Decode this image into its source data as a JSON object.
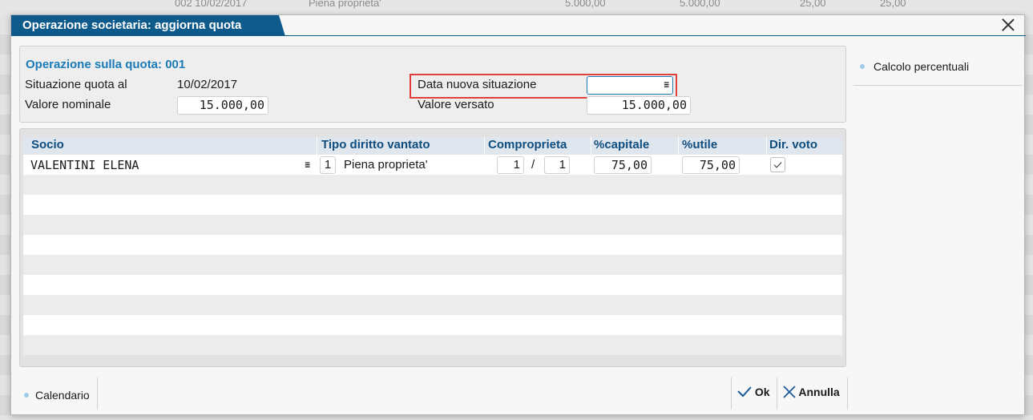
{
  "background_row": {
    "cells": [
      "002 10/02/2017",
      "Piena proprieta'",
      "5.000,00",
      "5.000,00",
      "25,00",
      "25,00"
    ]
  },
  "dialog": {
    "title": "Operazione societaria: aggiorna quota",
    "close_icon": "close-icon"
  },
  "header_panel": {
    "section_title": "Operazione sulla quota: 001",
    "situazione_label": "Situazione quota al",
    "situazione_value": "10/02/2017",
    "valore_nominale_label": "Valore nominale",
    "valore_nominale_value": "15.000,00",
    "data_nuova_label": "Data nuova situazione",
    "data_nuova_value": "",
    "valore_versato_label": "Valore versato",
    "valore_versato_value": "15.000,00",
    "menu_icon": "menu-icon"
  },
  "grid": {
    "columns": [
      "Socio",
      "Tipo diritto vantato",
      "Comproprieta",
      "%capitale",
      "%utile",
      "Dir. voto"
    ],
    "rows": [
      {
        "socio": "VALENTINI ELENA",
        "tipo_code": "1",
        "tipo_desc": "Piena proprieta'",
        "compro_num": "1",
        "compro_sep": "/",
        "compro_den": "1",
        "capitale": "75,00",
        "utile": "75,00",
        "dir_voto": true
      }
    ]
  },
  "side_panel": {
    "items": [
      {
        "label": "Calcolo percentuali"
      }
    ]
  },
  "footer": {
    "calendario_label": "Calendario",
    "ok_label": "Ok",
    "annulla_label": "Annulla"
  },
  "colors": {
    "accent": "#0e5a8a",
    "section_title": "#1a7bb8",
    "highlight": "#e0403a"
  }
}
